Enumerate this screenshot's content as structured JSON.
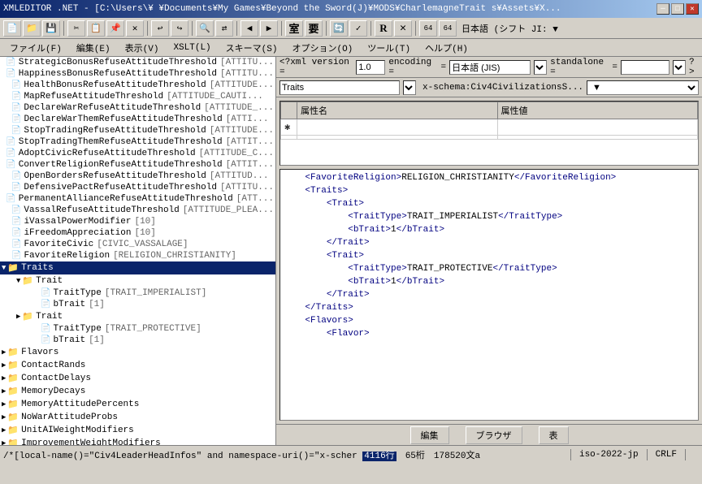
{
  "titlebar": {
    "text": "XMLEDITOR .NET - [C:\\Users\\¥      ¥Documents¥My Games¥Beyond the Sword(J)¥MODS¥CharlemagneTrait s¥Assets¥X...",
    "min_btn": "─",
    "max_btn": "□",
    "close_btn": "✕"
  },
  "menubar": {
    "items": [
      {
        "label": "ファイル(F)"
      },
      {
        "label": "編集(E)"
      },
      {
        "label": "表示(V)"
      },
      {
        "label": "XSLT(L)"
      },
      {
        "label": "スキーマ(S)"
      },
      {
        "label": "オプション(O)"
      },
      {
        "label": "ツール(T)"
      },
      {
        "label": "ヘルプ(H)"
      }
    ]
  },
  "xml_decl": {
    "label_version": "<?xml version =",
    "value_version": "1.0",
    "label_encoding": "encoding =",
    "encoding_value": "日本語 (JIS)",
    "label_standalone": "standalone =",
    "standalone_value": ""
  },
  "doc_info": {
    "doc_name": "Traits",
    "schema_label": "x-schema:Civ4CivilizationsS..."
  },
  "attr_table": {
    "headers": [
      "属性名",
      "属性値"
    ],
    "rows": []
  },
  "tree": {
    "items": [
      {
        "indent": 0,
        "type": "file",
        "label": "StrategicBonusRefuseAttitudeThreshold",
        "tag": "[ATTITU..."
      },
      {
        "indent": 0,
        "type": "file",
        "label": "HappinessBonusRefuseAttitudeThreshold",
        "tag": "[ATTITU..."
      },
      {
        "indent": 0,
        "type": "file",
        "label": "HealthBonusRefuseAttitudeThreshold",
        "tag": "[ATTITUDE..."
      },
      {
        "indent": 0,
        "type": "file",
        "label": "MapRefuseAttitudeThreshold",
        "tag": "[ATTITUDE_CAUTI..."
      },
      {
        "indent": 0,
        "type": "file",
        "label": "DeclareWarRefuseAttitudeThreshold",
        "tag": "[ATTITUDE_..."
      },
      {
        "indent": 0,
        "type": "file",
        "label": "DeclareWarThemRefuseAttitudeThreshold",
        "tag": "[ATTI..."
      },
      {
        "indent": 0,
        "type": "file",
        "label": "StopTradingRefuseAttitudeThreshold",
        "tag": "[ATTITUDE..."
      },
      {
        "indent": 0,
        "type": "file",
        "label": "StopTradingThemRefuseAttitudeThreshold",
        "tag": "[ATTIT..."
      },
      {
        "indent": 0,
        "type": "file",
        "label": "AdoptCivicRefuseAttitudeThreshold",
        "tag": "[ATTITUDE_C..."
      },
      {
        "indent": 0,
        "type": "file",
        "label": "ConvertReligionRefuseAttitudeThreshold",
        "tag": "[ATTIT..."
      },
      {
        "indent": 0,
        "type": "file",
        "label": "OpenBordersRefuseAttitudeThreshold",
        "tag": "[ATTITUD..."
      },
      {
        "indent": 0,
        "type": "file",
        "label": "DefensivePactRefuseAttitudeThreshold",
        "tag": "[ATTITU..."
      },
      {
        "indent": 0,
        "type": "file",
        "label": "PermanentAllianceRefuseAttitudeThreshold",
        "tag": "[ATT..."
      },
      {
        "indent": 0,
        "type": "file",
        "label": "VassalRefuseAttitudeThreshold",
        "tag": "[ATTITUDE_PLEA..."
      },
      {
        "indent": 0,
        "type": "file",
        "label": "iVassalPowerModifier",
        "tag": "[10]"
      },
      {
        "indent": 0,
        "type": "file",
        "label": "iFreedomAppreciation",
        "tag": "[10]"
      },
      {
        "indent": 0,
        "type": "file",
        "label": "FavoriteCivic",
        "tag": "[CIVIC_VASSALAGE]"
      },
      {
        "indent": 0,
        "type": "file",
        "label": "FavoriteReligion",
        "tag": "[RELIGION_CHRISTIANITY]"
      },
      {
        "indent": 0,
        "type": "folder",
        "label": "Traits",
        "selected": true,
        "expanded": true
      },
      {
        "indent": 1,
        "type": "folder",
        "label": "Trait",
        "expanded": true
      },
      {
        "indent": 2,
        "type": "file",
        "label": "TraitType",
        "tag": "[TRAIT_IMPERIALIST]"
      },
      {
        "indent": 2,
        "type": "file",
        "label": "bTrait",
        "tag": "[1]"
      },
      {
        "indent": 1,
        "type": "folder",
        "label": "Trait",
        "expanded": false
      },
      {
        "indent": 2,
        "type": "file",
        "label": "TraitType",
        "tag": "[TRAIT_PROTECTIVE]"
      },
      {
        "indent": 2,
        "type": "file",
        "label": "bTrait",
        "tag": "[1]"
      },
      {
        "indent": 0,
        "type": "folder-closed",
        "label": "Flavors",
        "expanded": false
      },
      {
        "indent": 0,
        "type": "folder-closed",
        "label": "ContactRands",
        "expanded": false
      },
      {
        "indent": 0,
        "type": "folder-closed",
        "label": "ContactDelays",
        "expanded": false
      },
      {
        "indent": 0,
        "type": "folder-closed",
        "label": "MemoryDecays",
        "expanded": false
      },
      {
        "indent": 0,
        "type": "folder-closed",
        "label": "MemoryAttitudePercents",
        "expanded": false
      },
      {
        "indent": 0,
        "type": "folder-closed",
        "label": "NoWarAttitudeProbs",
        "expanded": false
      },
      {
        "indent": 0,
        "type": "folder-closed",
        "label": "UnitAIWeightModifiers",
        "expanded": false
      },
      {
        "indent": 0,
        "type": "folder-closed",
        "label": "ImprovementWeightModifiers",
        "expanded": false
      }
    ]
  },
  "xml_source": {
    "lines": [
      "    <FavoriteReligion>RELIGION_CHRISTIANITY</FavoriteReligion>",
      "    <Traits>",
      "        <Trait>",
      "            <TraitType>TRAIT_IMPERIALIST</TraitType>",
      "            <bTrait>1</bTrait>",
      "        </Trait>",
      "        <Trait>",
      "            <TraitType>TRAIT_PROTECTIVE</TraitType>",
      "            <bTrait>1</bTrait>",
      "        </Trait>",
      "    </Traits>",
      "    <Flavors>",
      "        <Flavor>"
    ]
  },
  "bottom_btns": [
    {
      "label": "編集"
    },
    {
      "label": "ブラウザ"
    },
    {
      "label": "表"
    }
  ],
  "statusbar": {
    "xpath": "/*[local-name()=\"Civ4LeaderHeadInfos\" and namespace-uri()=\"x-scher",
    "line": "4116行",
    "col": "65桁",
    "chars": "178520文",
    "encoding": "a",
    "charset": "iso-2022-jp",
    "linefeed": "CRLF",
    "extra": ""
  }
}
